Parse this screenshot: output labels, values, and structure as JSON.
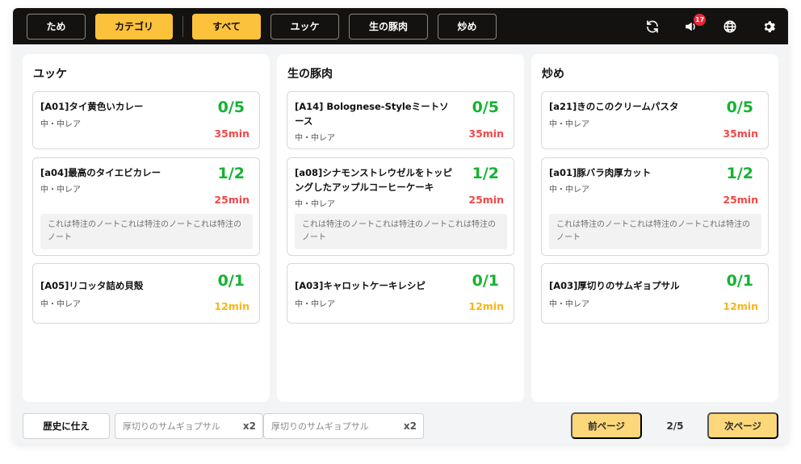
{
  "header": {
    "tabs": [
      {
        "label": "ため",
        "active": false
      },
      {
        "label": "カテゴリ",
        "active": true
      }
    ],
    "filters": [
      {
        "label": "すべて",
        "active": true
      },
      {
        "label": "ユッケ",
        "active": false
      },
      {
        "label": "生の豚肉",
        "active": false
      },
      {
        "label": "炒め",
        "active": false
      }
    ],
    "icons": [
      "refresh-icon",
      "notification-icon",
      "globe-icon",
      "gear-icon"
    ],
    "notification_count": "17"
  },
  "columns": [
    {
      "title": "ユッケ",
      "cards": [
        {
          "name": "[A01]タイ黄色いカレー",
          "spec": "中・中レア",
          "count": "0/5",
          "time": "35min",
          "time_color": "red",
          "note": ""
        },
        {
          "name": "[a04]最高のタイエビカレー",
          "spec": "中・中レア",
          "count": "1/2",
          "time": "25min",
          "time_color": "red",
          "note": "これは特注のノートこれは特注のノートこれは特注のノート"
        },
        {
          "name": "[A05]リコッタ詰め貝殻",
          "spec": "中・中レア",
          "count": "0/1",
          "time": "12min",
          "time_color": "yellow",
          "note": ""
        }
      ]
    },
    {
      "title": "生の豚肉",
      "cards": [
        {
          "name": "[A14] Bolognese-Styleミートソース",
          "spec": "中・中レア",
          "count": "0/5",
          "time": "35min",
          "time_color": "red",
          "note": ""
        },
        {
          "name": "[a08]シナモンストレウゼルをトッピングしたアップルコーヒーケーキ",
          "spec": "中・中レア",
          "count": "1/2",
          "time": "25min",
          "time_color": "red",
          "note": "これは特注のノートこれは特注のノートこれは特注のノート"
        },
        {
          "name": "[A03]キャロットケーキレシピ",
          "spec": "中・中レア",
          "count": "0/1",
          "time": "12min",
          "time_color": "yellow",
          "note": ""
        }
      ]
    },
    {
      "title": "炒め",
      "cards": [
        {
          "name": "[a21]きのこのクリームパスタ",
          "spec": "中・中レア",
          "count": "0/5",
          "time": "35min",
          "time_color": "red",
          "note": ""
        },
        {
          "name": "[a01]豚バラ肉厚カット",
          "spec": "中・中レア",
          "count": "1/2",
          "time": "25min",
          "time_color": "red",
          "note": "これは特注のノートこれは特注のノートこれは特注のノート"
        },
        {
          "name": "[A03]厚切りのサムギョプサル",
          "spec": "中・中レア",
          "count": "0/1",
          "time": "12min",
          "time_color": "yellow",
          "note": ""
        }
      ]
    }
  ],
  "footer": {
    "history_label": "歴史に仕え",
    "history_items": [
      {
        "name": "厚切りのサムギョプサル",
        "qty": "x2"
      },
      {
        "name": "厚切りのサムギョプサル",
        "qty": "x2"
      }
    ],
    "prev_label": "前ページ",
    "next_label": "次ページ",
    "page_indicator": "2/5"
  },
  "colors": {
    "header_bg": "#141210",
    "accent": "#fdc23c",
    "count_green": "#15b332",
    "time_red": "#ef4848",
    "time_yellow": "#f7b517",
    "pager_bg": "#fdd87b"
  }
}
